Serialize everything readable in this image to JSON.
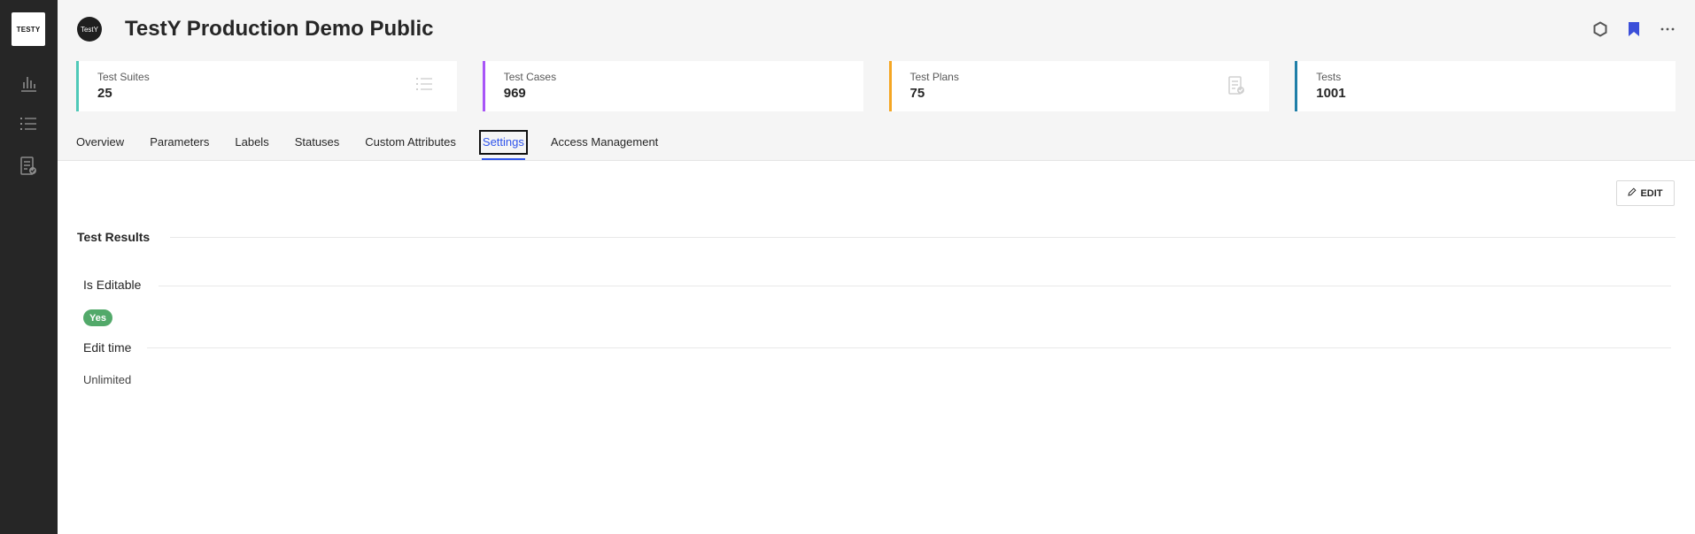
{
  "sidebar": {
    "logo": "TESTY",
    "items": [
      {
        "icon": "bar-chart-icon"
      },
      {
        "icon": "list-icon"
      },
      {
        "icon": "test-plan-icon"
      }
    ]
  },
  "header": {
    "avatar_text": "TestY",
    "title": "TestY Production Demo Public",
    "actions": [
      "settings-hexagon-icon",
      "bookmark-icon",
      "more-icon"
    ],
    "accent": "#3b4fd9"
  },
  "stats": [
    {
      "label": "Test Suites",
      "value": "25",
      "color": "#4fc9b8",
      "icon": "list-icon"
    },
    {
      "label": "Test Cases",
      "value": "969",
      "color": "#a855f7",
      "icon": ""
    },
    {
      "label": "Test Plans",
      "value": "75",
      "color": "#f5a623",
      "icon": "test-plan-icon"
    },
    {
      "label": "Tests",
      "value": "1001",
      "color": "#1f7fa8",
      "icon": ""
    }
  ],
  "tabs": [
    {
      "label": "Overview",
      "active": false
    },
    {
      "label": "Parameters",
      "active": false
    },
    {
      "label": "Labels",
      "active": false
    },
    {
      "label": "Statuses",
      "active": false
    },
    {
      "label": "Custom Attributes",
      "active": false
    },
    {
      "label": "Settings",
      "active": true
    },
    {
      "label": "Access Management",
      "active": false
    }
  ],
  "content": {
    "edit_label": "EDIT",
    "section_title": "Test Results",
    "is_editable_label": "Is Editable",
    "is_editable_value": "Yes",
    "edit_time_label": "Edit time",
    "edit_time_value": "Unlimited",
    "badge_color": "#52a96a"
  }
}
